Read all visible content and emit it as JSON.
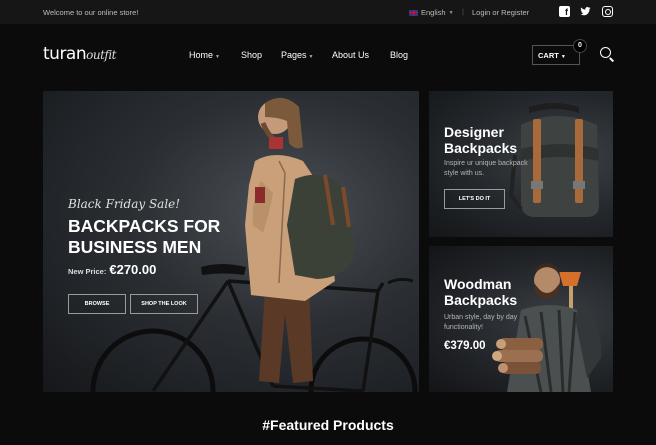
{
  "topbar": {
    "welcome": "Welcome to our online store!",
    "language": "English",
    "login": "Login or Register"
  },
  "brand": {
    "name": "turan",
    "script": "outfit"
  },
  "nav": {
    "home": "Home",
    "shop": "Shop",
    "pages": "Pages",
    "about": "About Us",
    "blog": "Blog"
  },
  "cart": {
    "label": "CART",
    "count": "0"
  },
  "hero": {
    "tagline": "Black Friday Sale!",
    "title": "BACKPACKS FOR BUSINESS MEN",
    "price_label": "New Price:",
    "price": "€270.00",
    "browse": "BROWSE",
    "shop_look": "SHOP THE LOOK"
  },
  "promo1": {
    "title": "Designer Backpacks",
    "subtitle": "Inspire ur unique backpack style with us.",
    "button": "LET'S DO IT"
  },
  "promo2": {
    "title": "Woodman Backpacks",
    "subtitle": "Urban style, day by day functionality!",
    "price": "€379.00"
  },
  "featured": {
    "title": "#Featured Products"
  },
  "icons": [
    "facebook-icon",
    "twitter-icon",
    "instagram-icon",
    "search-icon",
    "chevron-down-icon",
    "flag-icon"
  ]
}
